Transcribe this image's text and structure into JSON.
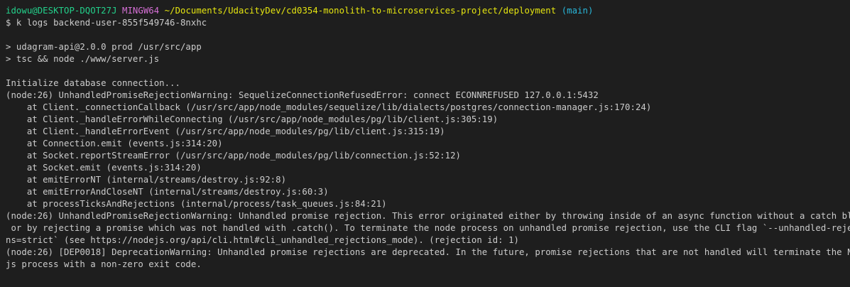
{
  "prompt": {
    "user_host": "idowu@DESKTOP-DQOT27J",
    "shell": "MINGW64",
    "path": "~/Documents/UdacityDev/cd0354-monolith-to-microservices-project/deployment",
    "branch": "(main)",
    "command_line": "$ k logs backend-user-855f549746-8nxhc"
  },
  "output": {
    "npm_line_1": "> udagram-api@2.0.0 prod /usr/src/app",
    "npm_line_2": "> tsc && node ./www/server.js",
    "init_line": "Initialize database connection...",
    "warning_line": "(node:26) UnhandledPromiseRejectionWarning: SequelizeConnectionRefusedError: connect ECONNREFUSED 127.0.0.1:5432",
    "stack": [
      "    at Client._connectionCallback (/usr/src/app/node_modules/sequelize/lib/dialects/postgres/connection-manager.js:170:24)",
      "    at Client._handleErrorWhileConnecting (/usr/src/app/node_modules/pg/lib/client.js:305:19)",
      "    at Client._handleErrorEvent (/usr/src/app/node_modules/pg/lib/client.js:315:19)",
      "    at Connection.emit (events.js:314:20)",
      "    at Socket.reportStreamError (/usr/src/app/node_modules/pg/lib/connection.js:52:12)",
      "    at Socket.emit (events.js:314:20)",
      "    at emitErrorNT (internal/streams/destroy.js:92:8)",
      "    at emitErrorAndCloseNT (internal/streams/destroy.js:60:3)",
      "    at processTicksAndRejections (internal/process/task_queues.js:84:21)"
    ],
    "rejection_lines": [
      "(node:26) UnhandledPromiseRejectionWarning: Unhandled promise rejection. This error originated either by throwing inside of an async function without a catch block,",
      " or by rejecting a promise which was not handled with .catch(). To terminate the node process on unhandled promise rejection, use the CLI flag `--unhandled-rejectio",
      "ns=strict` (see https://nodejs.org/api/cli.html#cli_unhandled_rejections_mode). (rejection id: 1)"
    ],
    "deprecation_lines": [
      "(node:26) [DEP0018] DeprecationWarning: Unhandled promise rejections are deprecated. In the future, promise rejections that are not handled will terminate the Node.",
      "js process with a non-zero exit code."
    ]
  },
  "colors": {
    "background": "#1e1e1e",
    "foreground": "#cccccc",
    "user_host": "#23d18b",
    "shell": "#d670d6",
    "path": "#e5e510",
    "branch": "#29b8db"
  }
}
